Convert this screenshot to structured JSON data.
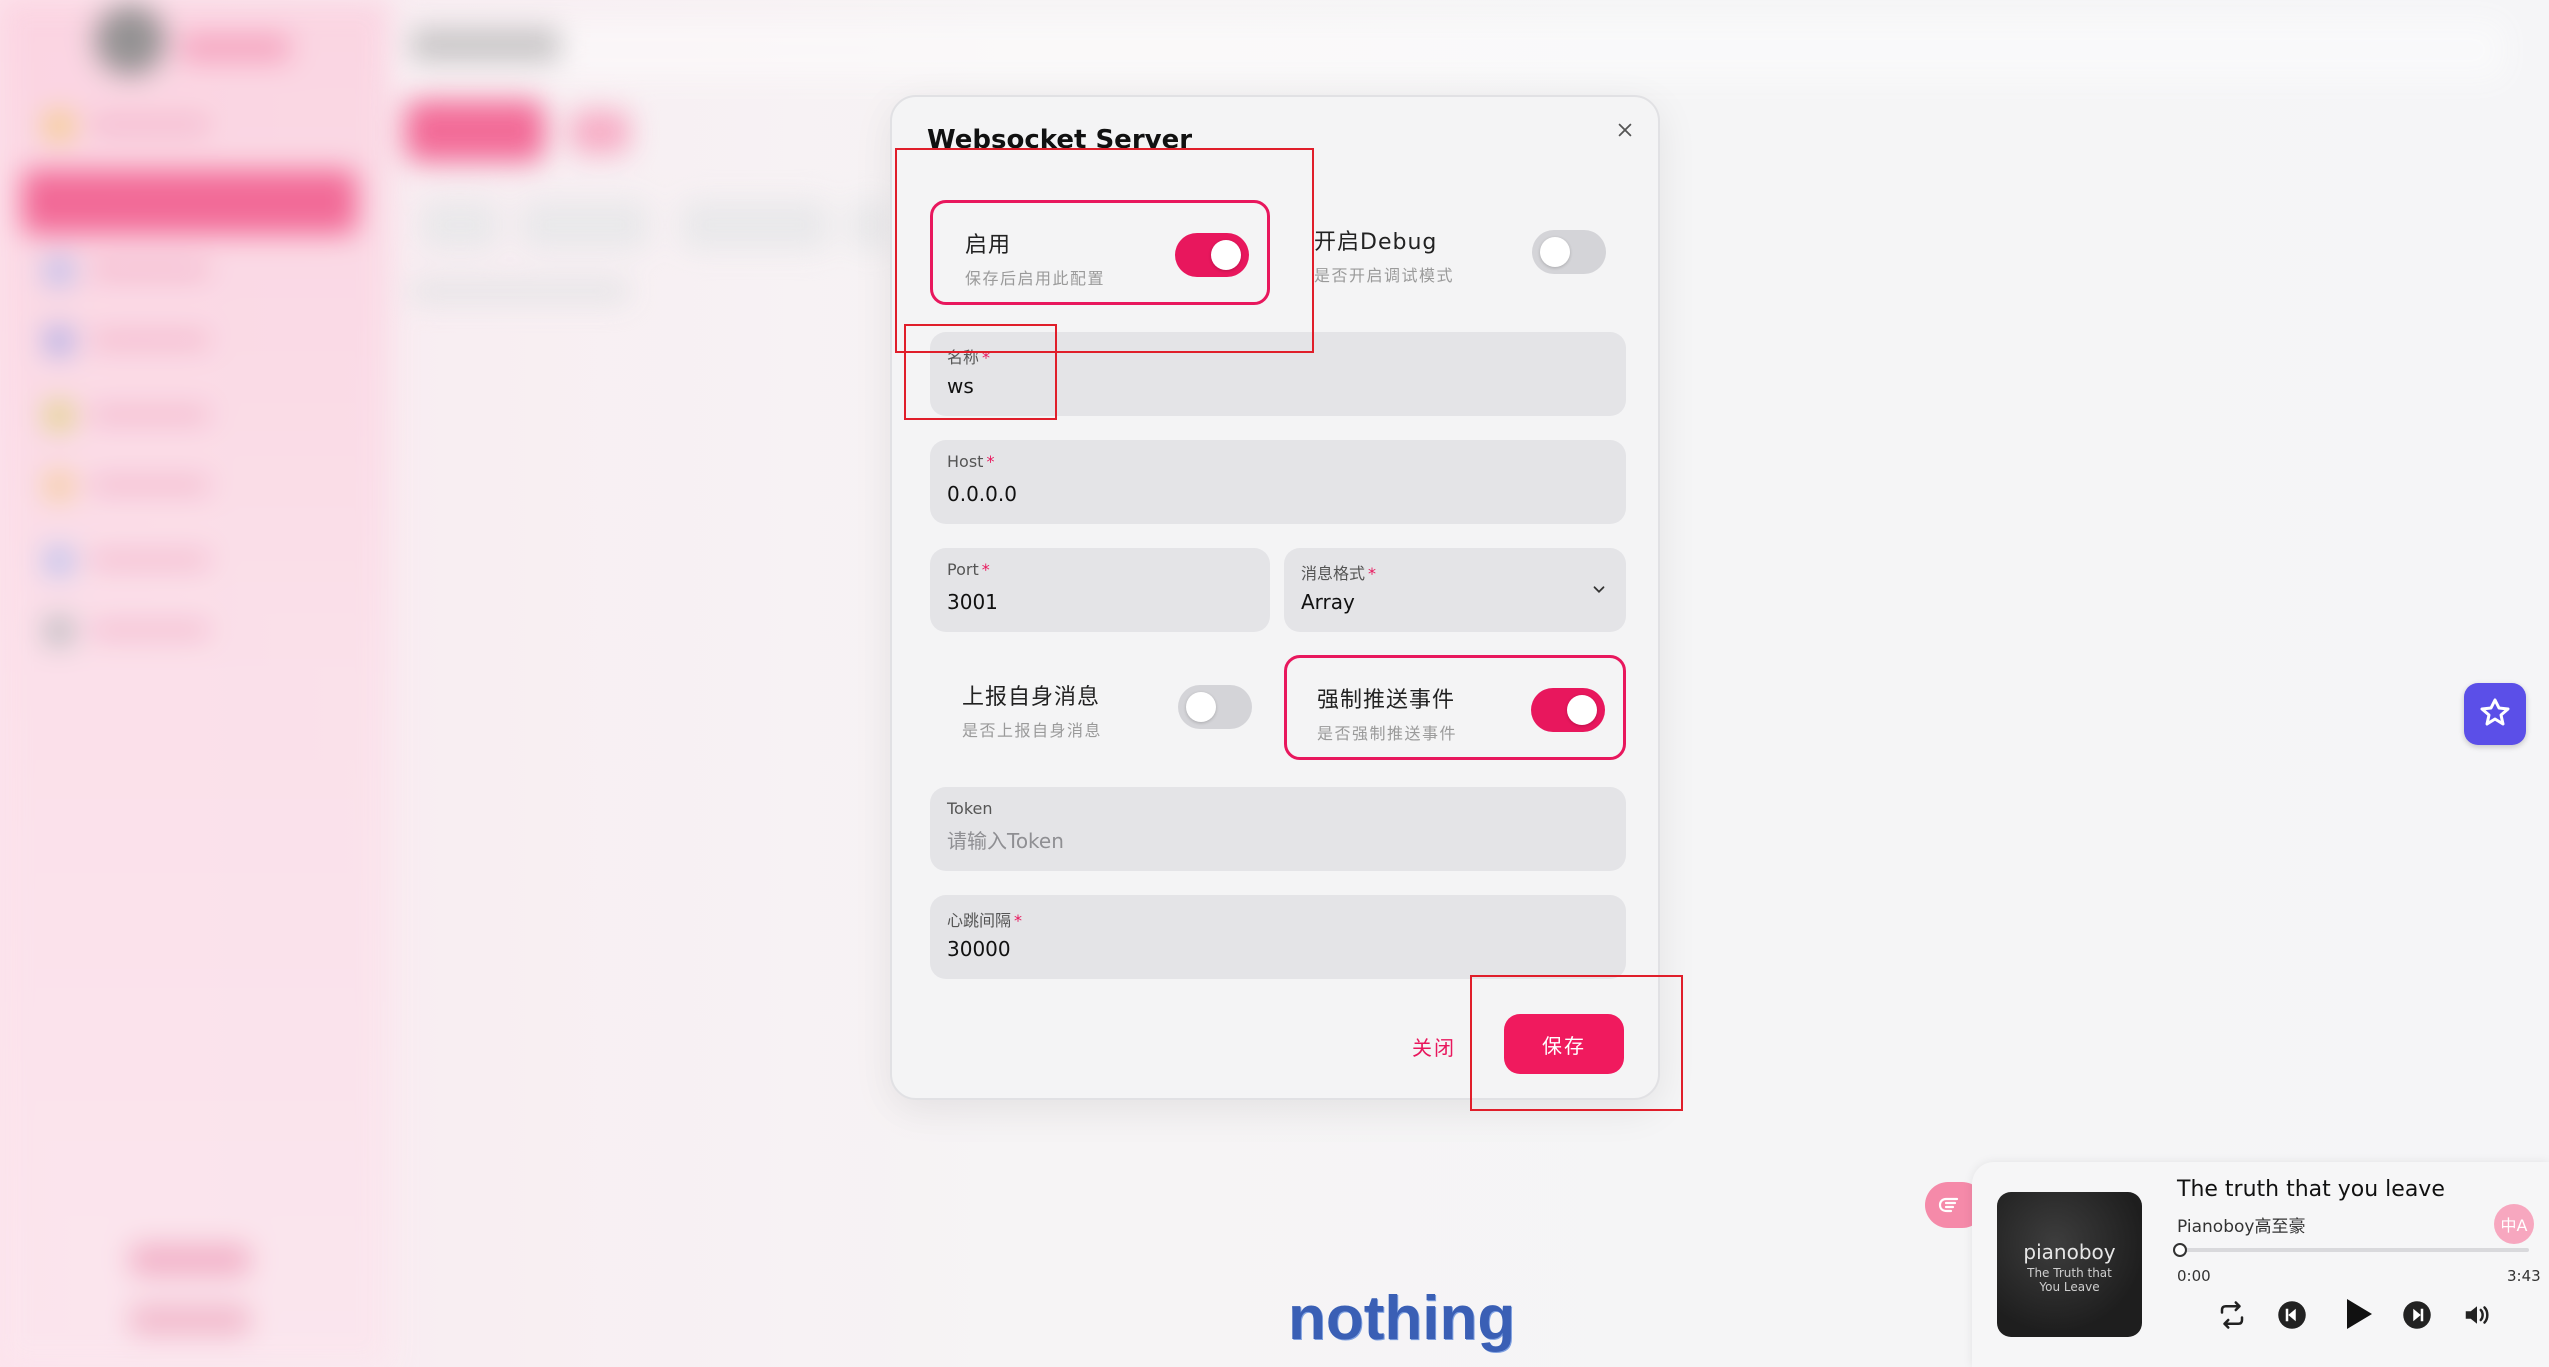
{
  "dialog": {
    "title": "Websocket Server",
    "enable": {
      "label": "启用",
      "desc": "保存后启用此配置",
      "on": true
    },
    "debug": {
      "label": "开启Debug",
      "desc": "是否开启调试模式",
      "on": false
    },
    "name": {
      "label": "名称",
      "value": "ws"
    },
    "host": {
      "label": "Host",
      "value": "0.0.0.0"
    },
    "port": {
      "label": "Port",
      "value": "3001"
    },
    "format": {
      "label": "消息格式",
      "value": "Array"
    },
    "report_self": {
      "label": "上报自身消息",
      "desc": "是否上报自身消息",
      "on": false
    },
    "force_push": {
      "label": "强制推送事件",
      "desc": "是否强制推送事件",
      "on": true
    },
    "token": {
      "label": "Token",
      "placeholder": "请输入Token",
      "value": ""
    },
    "heartbeat": {
      "label": "心跳间隔",
      "value": "30000"
    },
    "close_label": "关闭",
    "save_label": "保存"
  },
  "player": {
    "cover_title": "pianoboy",
    "cover_subtitle": "The Truth that You Leave",
    "song_title": "The truth that you leave",
    "artist": "Pianoboy高至豪",
    "current_time": "0:00",
    "total_time": "3:43",
    "progress": 0,
    "translate_glyph": "中A"
  },
  "caption": "nothing",
  "colors": {
    "accent": "#e8175d",
    "annotation": "#e01e2a",
    "float_button": "#5b4fe8"
  }
}
